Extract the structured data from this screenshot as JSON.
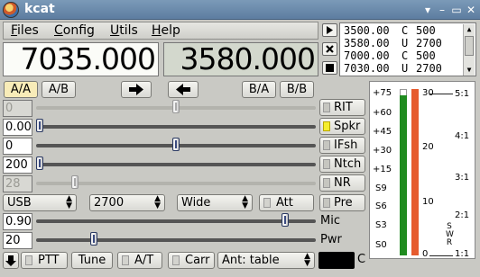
{
  "window": {
    "title": "kcat",
    "buttons": [
      "▾",
      "–",
      "▭",
      "✕"
    ]
  },
  "menu": {
    "items": [
      {
        "mnemonic": "F",
        "rest": "iles"
      },
      {
        "mnemonic": "C",
        "rest": "onfig"
      },
      {
        "mnemonic": "U",
        "rest": "tils"
      },
      {
        "mnemonic": "H",
        "rest": "elp"
      }
    ]
  },
  "freq": {
    "a": "7035.000",
    "b": "3580.000"
  },
  "memory": {
    "rows": [
      {
        "freq": "3500.00",
        "mode": "C",
        "bw": "500"
      },
      {
        "freq": "3580.00",
        "mode": "U",
        "bw": "2700"
      },
      {
        "freq": "7000.00",
        "mode": "C",
        "bw": "500"
      },
      {
        "freq": "7030.00",
        "mode": "U",
        "bw": "2700"
      }
    ]
  },
  "vfo": {
    "aa": "A/A",
    "ab": "A/B",
    "ba": "B/A",
    "bb": "B/B",
    "right_arrow": "🡆",
    "left_arrow": "🡄"
  },
  "sliders": {
    "rit": {
      "value": "0",
      "level": 0.5
    },
    "volume": {
      "value": "0.00",
      "level": 0.0
    },
    "ifshift": {
      "value": "0",
      "level": 0.5
    },
    "notch": {
      "value": "200",
      "level": 0.0
    },
    "nr": {
      "value": "28",
      "level": 0.13
    },
    "mic": {
      "value": "0.90",
      "level": 0.9
    },
    "power": {
      "value": "20",
      "level": 0.2
    }
  },
  "side": {
    "rit": "RIT",
    "spkr": "Spkr",
    "ifsh": "IFsh",
    "ntch": "Ntch",
    "nr": "NR",
    "pre": "Pre"
  },
  "controls": {
    "mode": "USB",
    "bandwidth": "2700",
    "filter": "Wide",
    "att": "Att",
    "mic_label": "Mic",
    "pwr_label": "Pwr"
  },
  "bottom": {
    "ptt": "PTT",
    "tune": "Tune",
    "at": "A/T",
    "carr": "Carr",
    "antenna": "Ant: table",
    "c": "C"
  },
  "meter": {
    "power_scale": [
      "30",
      "20",
      "10",
      "0"
    ],
    "smeter_scale": [
      "+75",
      "+60",
      "+45",
      "+30",
      "+15",
      "S9",
      "S6",
      "S3",
      "S0"
    ],
    "swr_scale": [
      "5:1",
      "4:1",
      "3:1",
      "2:1",
      "1:1"
    ],
    "swr_label": [
      "S",
      "W",
      "R"
    ],
    "s_level": 0.96,
    "colors": {
      "s": "#1f8b1f",
      "pwr": "#e65b2e"
    }
  }
}
